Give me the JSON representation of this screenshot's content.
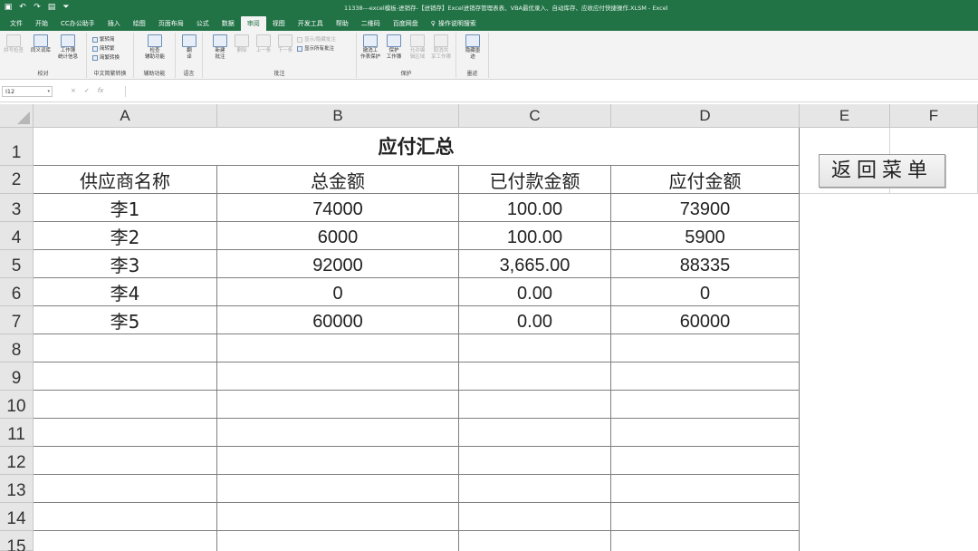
{
  "window": {
    "qat_icons": [
      "save-icon",
      "undo-icon",
      "redo-icon",
      "form-icon",
      "customize-icon"
    ],
    "title": "11338---excel模板-进销存-【进销存】Excel进销存管理表表、VBA最优录入、自动库存、应收应付快捷操作.XLSM  -  Excel"
  },
  "ribbon_tabs": [
    "文件",
    "开始",
    "CC办公助手",
    "插入",
    "绘图",
    "页面布局",
    "公式",
    "数据",
    "审阅",
    "视图",
    "开发工具",
    "帮助",
    "二维码",
    "百度网盘"
  ],
  "active_tab": "审阅",
  "tell_me": "操作说明搜索",
  "ribbon": {
    "proofing": {
      "label": "校对",
      "spell": "拼写检查",
      "thesaurus": "同义词库",
      "stats": "工作簿\n统计信息"
    },
    "chinese": {
      "label": "中文简繁转换",
      "to_simplified": "繁转简",
      "to_traditional": "简转繁",
      "convert": "简繁转换"
    },
    "accessibility": {
      "label": "辅助功能",
      "check": "检查\n辅助功能"
    },
    "language": {
      "label": "语言",
      "translate": "翻\n译"
    },
    "comments": {
      "label": "批注",
      "new": "新建\n批注",
      "delete": "删除",
      "prev": "上一条",
      "next": "下一条",
      "show_hide": "显示/隐藏批注",
      "show_all": "显示所有批注"
    },
    "protect": {
      "label": "保护",
      "unprotect_sheet": "撤消工\n作表保护",
      "protect_workbook": "保护\n工作簿",
      "allow_edit": "允许编\n辑区域",
      "unshare": "取消共\n享工作簿"
    },
    "ink": {
      "label": "墨迹",
      "hide_ink": "隐藏墨\n迹"
    }
  },
  "formula_bar": {
    "name_box": "I12",
    "cancel": "×",
    "enter": "✓",
    "fx": "fx",
    "value": ""
  },
  "columns": [
    "A",
    "B",
    "C",
    "D",
    "E",
    "F"
  ],
  "rows": [
    "1",
    "2",
    "3",
    "4",
    "5",
    "6",
    "7",
    "8",
    "9",
    "10",
    "11",
    "12",
    "13",
    "14",
    "15"
  ],
  "sheet": {
    "title": "应付汇总",
    "headers": [
      "供应商名称",
      "总金额",
      "已付款金额",
      "应付金额"
    ],
    "data": [
      [
        "李1",
        "74000",
        "100.00",
        "73900"
      ],
      [
        "李2",
        "6000",
        "100.00",
        "5900"
      ],
      [
        "李3",
        "92000",
        "3,665.00",
        "88335"
      ],
      [
        "李4",
        "0",
        "0.00",
        "0"
      ],
      [
        "李5",
        "60000",
        "0.00",
        "60000"
      ]
    ],
    "menu_button": "返回菜单"
  }
}
